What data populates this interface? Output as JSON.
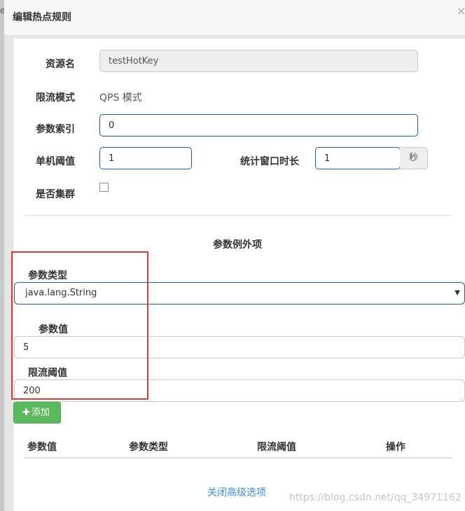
{
  "modal": {
    "title": "编辑热点规则",
    "close_glyph": "×",
    "edge_glyph": "e"
  },
  "form": {
    "resource": {
      "label": "资源名",
      "value": "testHotKey"
    },
    "mode": {
      "label": "限流模式",
      "value": "QPS 模式"
    },
    "param_index": {
      "label": "参数索引",
      "value": "0"
    },
    "threshold": {
      "label": "单机阈值",
      "value": "1"
    },
    "window": {
      "label": "统计窗口时长",
      "value": "1",
      "unit": "秒"
    },
    "cluster": {
      "label": "是否集群",
      "checked": false
    }
  },
  "exceptions": {
    "section_title": "参数例外项",
    "param_type": {
      "label": "参数类型",
      "selected": "java.lang.String"
    },
    "param_value": {
      "label": "参数值",
      "value": "5"
    },
    "limit_threshold": {
      "label": "限流阈值",
      "value": "200"
    },
    "add_button": {
      "icon": "plus-icon",
      "label": "添加"
    }
  },
  "table": {
    "columns": [
      "参数值",
      "参数类型",
      "限流阈值",
      "操作"
    ]
  },
  "footer": {
    "close_advanced": "关闭高级选项"
  },
  "watermark": "https://blog.csdn.net/qq_34971162",
  "colors": {
    "accent": "#1a5fb4",
    "add_button": "#5cb85c",
    "link": "#3a8ee6",
    "highlight": "#e03a3a"
  }
}
